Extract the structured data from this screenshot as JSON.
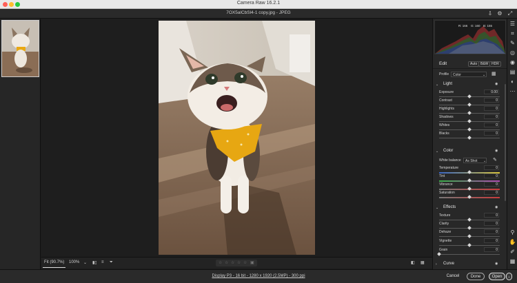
{
  "window": {
    "title": "Camera Raw 16.2.1"
  },
  "file": {
    "name": "7OX5alCbSl4-1 copy.jpg  -  JPEG"
  },
  "toolbar": {
    "zoom_fit": "Fit (90.7%)",
    "zoom_level": "100%"
  },
  "rating": {
    "stars": 0,
    "max": 5
  },
  "footer": {
    "info": "Display P3 - 16 bit - 1280 x 1920 (2.5MP) - 300 ppi",
    "cancel": "Cancel",
    "done": "Done",
    "open": "Open"
  },
  "histogram": {
    "r": "R: 166",
    "g": "G: 160",
    "b": "B: 155"
  },
  "edit": {
    "title": "Edit",
    "auto": "Auto",
    "bw": "B&W",
    "hdr": "HDR",
    "profile_label": "Profile",
    "profile_value": "Color"
  },
  "light": {
    "title": "Light",
    "exposure": {
      "label": "Exposure",
      "value": "0.00"
    },
    "contrast": {
      "label": "Contrast",
      "value": "0"
    },
    "highlights": {
      "label": "Highlights",
      "value": "0"
    },
    "shadows": {
      "label": "Shadows",
      "value": "0"
    },
    "whites": {
      "label": "Whites",
      "value": "0"
    },
    "blacks": {
      "label": "Blacks",
      "value": "0"
    }
  },
  "color": {
    "title": "Color",
    "wb_label": "White balance",
    "wb_value": "As Shot",
    "temperature": {
      "label": "Temperature",
      "value": "0"
    },
    "tint": {
      "label": "Tint",
      "value": "0"
    },
    "vibrance": {
      "label": "Vibrance",
      "value": "0"
    },
    "saturation": {
      "label": "Saturation",
      "value": "0"
    }
  },
  "effects": {
    "title": "Effects",
    "texture": {
      "label": "Texture",
      "value": "0"
    },
    "clarity": {
      "label": "Clarity",
      "value": "0"
    },
    "dehaze": {
      "label": "Dehaze",
      "value": "0"
    },
    "vignette": {
      "label": "Vignette",
      "value": "0"
    },
    "grain": {
      "label": "Grain",
      "value": "0"
    }
  },
  "curve": {
    "title": "Curve"
  },
  "icons": {
    "close": "close-dot",
    "minimize": "minimize-dot",
    "maximize": "maximize-dot",
    "save": "save-icon",
    "settings": "gear-icon",
    "fullscreen": "expand-icon"
  },
  "colors": {
    "accent": "#4a90e2",
    "traffic_red": "#ff5f57",
    "traffic_yellow": "#febc2e",
    "traffic_green": "#28c840"
  }
}
